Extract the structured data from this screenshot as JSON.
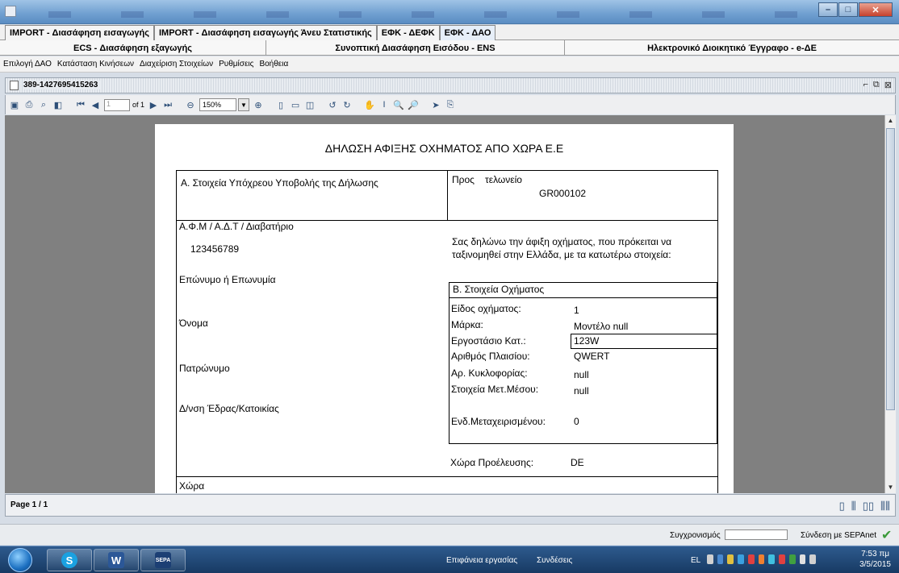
{
  "tabs_row1": [
    {
      "label": "IMPORT - Διασάφηση εισαγωγής",
      "active": false
    },
    {
      "label": "IMPORT - Διασάφηση εισαγωγής Άνευ Στατιστικής",
      "active": false
    },
    {
      "label": "ΕΦΚ - ΔΕΦΚ",
      "active": false
    },
    {
      "label": "ΕΦΚ - ΔΑΟ",
      "active": true
    }
  ],
  "tabs_row2": [
    {
      "label": "ECS - Διασάφηση εξαγωγής"
    },
    {
      "label": "Συνοπτική Διασάφηση Εισόδου - ENS"
    },
    {
      "label": "Ηλεκτρονικό Διοικητικό Έγγραφο - e-ΔΕ"
    }
  ],
  "menu": [
    "Επιλογή ΔΑΟ",
    "Κατάσταση Κινήσεων",
    "Διαχείριση Στοιχείων",
    "Ρυθμίσεις",
    "Βοήθεια"
  ],
  "frame_title": "389-1427695415263",
  "toolbar": {
    "page_value": "1",
    "of_label": "of 1",
    "zoom": "150%"
  },
  "document": {
    "title": "ΔΗΛΩΣΗ ΑΦΙΞΗΣ ΟΧΗΜΑΤΟΣ ΑΠΟ ΧΩΡΑ Ε.Ε",
    "section_a": "Α. Στοιχεία Υπόχρεου Υποβολής της Δήλωσης",
    "pros_label": "Προς",
    "teloneio_label": "τελωνείο",
    "teloneio_value": "GR000102",
    "afm_label": "Α.Φ.Μ / Α.Δ.Τ / Διαβατήριο",
    "afm_value": "123456789",
    "declaration_line1": "Σας δηλώνω την άφιξη οχήματος, που πρόκειται να",
    "declaration_line2": "ταξινομηθεί στην Ελλάδα, με τα κατωτέρω στοιχεία:",
    "eponymo_label": "Επώνυμο ή Επωνυμία",
    "onoma_label": "Όνομα",
    "patronymo_label": "Πατρώνυμο",
    "dnsi_label": "Δ/νση Έδρας/Κατοικίας",
    "chora_label": "Χώρα",
    "section_b": "Β. Στοιχεία Οχήματος",
    "vehicle_fields": [
      {
        "label": "Είδος οχήματος:",
        "value": "1"
      },
      {
        "label": "Μάρκα:",
        "value": "Μοντέλο null"
      },
      {
        "label": "Εργοστάσιο Κατ.:",
        "value": "123W"
      },
      {
        "label": "Αριθμός Πλαισίου:",
        "value": "QWERT"
      },
      {
        "label": "Αρ. Κυκλοφορίας:",
        "value": "null"
      },
      {
        "label": "Στοιχεία Μετ.Μέσου:",
        "value": "null"
      },
      {
        "label": "Ενδ.Μεταχειρισμένου:",
        "value": "0"
      }
    ],
    "origin_label": "Χώρα Προέλευσης:",
    "origin_value": "DE"
  },
  "status": {
    "page": "Page 1 / 1"
  },
  "bottom": {
    "sync_label": "Συγχρονισμός",
    "sepa_label": "Σύνδεση με SEPAnet"
  },
  "taskbar": {
    "desktop_label": "Επιφάνεια εργασίας",
    "connections_label": "Συνδέσεις",
    "lang": "EL",
    "time": "7:53 πμ",
    "date": "3/5/2015"
  },
  "colors": {
    "taskbar": "#173a63",
    "viewer_bg": "#808080",
    "accent": "#2d4f78"
  }
}
